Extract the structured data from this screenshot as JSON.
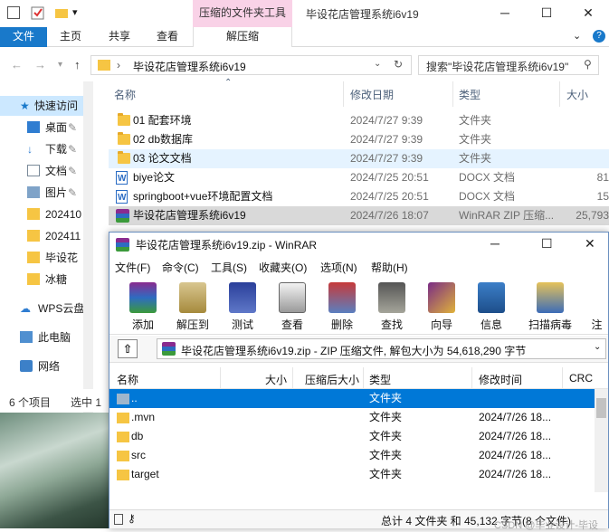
{
  "explorer": {
    "title": "毕设花店管理系统i6v19",
    "context_tab": "压缩的文件夹工具",
    "ribbon_tabs": [
      "文件",
      "主页",
      "共享",
      "查看",
      "解压缩"
    ],
    "address": "毕设花店管理系统i6v19",
    "search_placeholder": "搜索\"毕设花店管理系统i6v19\"",
    "columns": {
      "name": "名称",
      "date": "修改日期",
      "type": "类型",
      "size": "大小"
    },
    "files": [
      {
        "name": "01 配套环境",
        "date": "2024/7/27 9:39",
        "type": "文件夹",
        "size": "",
        "icon": "folder-icon"
      },
      {
        "name": "02 db数据库",
        "date": "2024/7/27 9:39",
        "type": "文件夹",
        "size": "",
        "icon": "folder-icon"
      },
      {
        "name": "03 论文文档",
        "date": "2024/7/27 9:39",
        "type": "文件夹",
        "size": "",
        "icon": "folder-icon"
      },
      {
        "name": "biye论文",
        "date": "2024/7/25 20:51",
        "type": "DOCX 文档",
        "size": "81",
        "icon": "docx-icon"
      },
      {
        "name": "springboot+vue环境配置文档",
        "date": "2024/7/25 20:51",
        "type": "DOCX 文档",
        "size": "15",
        "icon": "docx-icon"
      },
      {
        "name": "毕设花店管理系统i6v19",
        "date": "2024/7/26 18:07",
        "type": "WinRAR ZIP 压缩...",
        "size": "25,793",
        "icon": "rar-icon"
      }
    ],
    "nav_items": [
      "快速访问",
      "桌面",
      "下载",
      "文档",
      "图片",
      "202410",
      "202411",
      "毕设花",
      "冰糖",
      "WPS云盘",
      "此电脑",
      "网络"
    ],
    "status_count": "6 个项目",
    "status_selected": "选中 1"
  },
  "winrar": {
    "title": "毕设花店管理系统i6v19.zip - WinRAR",
    "menu": [
      "文件(F)",
      "命令(C)",
      "工具(S)",
      "收藏夹(O)",
      "选项(N)",
      "帮助(H)"
    ],
    "toolbar": [
      "添加",
      "解压到",
      "测试",
      "查看",
      "删除",
      "查找",
      "向导",
      "信息",
      "扫描病毒",
      "注"
    ],
    "path": "毕设花店管理系统i6v19.zip - ZIP 压缩文件, 解包大小为 54,618,290 字节",
    "columns": {
      "name": "名称",
      "size": "大小",
      "packed": "压缩后大小",
      "type": "类型",
      "modified": "修改时间",
      "crc": "CRC"
    },
    "rows": [
      {
        "name": "..",
        "size": "",
        "packed": "",
        "type": "文件夹",
        "modified": ""
      },
      {
        "name": ".mvn",
        "size": "",
        "packed": "",
        "type": "文件夹",
        "modified": "2024/7/26 18..."
      },
      {
        "name": "db",
        "size": "",
        "packed": "",
        "type": "文件夹",
        "modified": "2024/7/26 18..."
      },
      {
        "name": "src",
        "size": "",
        "packed": "",
        "type": "文件夹",
        "modified": "2024/7/26 18..."
      },
      {
        "name": "target",
        "size": "",
        "packed": "",
        "type": "文件夹",
        "modified": "2024/7/26 18..."
      }
    ],
    "status": "总计 4 文件夹 和 45,132 字节(8 个文件)",
    "watermark": "CSDN @毕业设计-毕设"
  }
}
